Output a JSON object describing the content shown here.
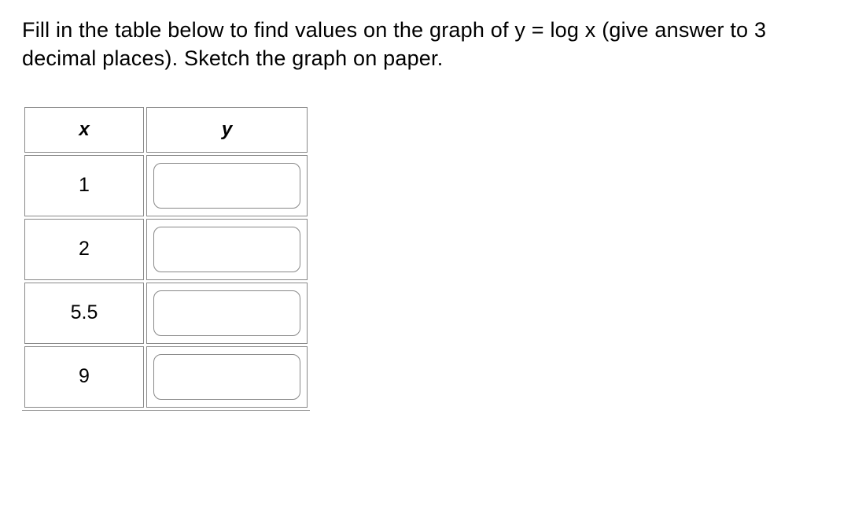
{
  "question": {
    "text": "Fill in the table below to find values on the graph of y = log x (give answer to 3 decimal places). Sketch the graph on paper."
  },
  "table": {
    "headers": {
      "x": "x",
      "y": "y"
    },
    "rows": [
      {
        "x": "1",
        "y": ""
      },
      {
        "x": "2",
        "y": ""
      },
      {
        "x": "5.5",
        "y": ""
      },
      {
        "x": "9",
        "y": ""
      }
    ]
  }
}
